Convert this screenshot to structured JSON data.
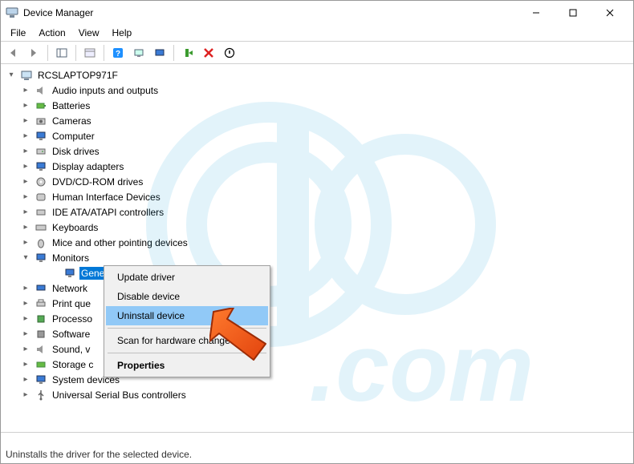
{
  "window": {
    "title": "Device Manager"
  },
  "menu": {
    "file": "File",
    "action": "Action",
    "view": "View",
    "help": "Help"
  },
  "tree": {
    "root": "RCSLAPTOP971F",
    "categories": {
      "audio": "Audio inputs and outputs",
      "batteries": "Batteries",
      "cameras": "Cameras",
      "computer": "Computer",
      "disk": "Disk drives",
      "display": "Display adapters",
      "dvd": "DVD/CD-ROM drives",
      "hid": "Human Interface Devices",
      "ide": "IDE ATA/ATAPI controllers",
      "keyboards": "Keyboards",
      "mice": "Mice and other pointing devices",
      "monitors": "Monitors",
      "network": "Network",
      "printq": "Print que",
      "processors": "Processo",
      "software": "Software",
      "sound": "Sound, v",
      "storage": "Storage c",
      "system": "System devices",
      "usb": "Universal Serial Bus controllers"
    },
    "monitor_child": "Gene"
  },
  "context_menu": {
    "update": "Update driver",
    "disable": "Disable device",
    "uninstall": "Uninstall device",
    "scan": "Scan for hardware change",
    "properties": "Properties"
  },
  "statusbar": {
    "text": "Uninstalls the driver for the selected device."
  },
  "watermark": {
    "domain": ".com"
  }
}
